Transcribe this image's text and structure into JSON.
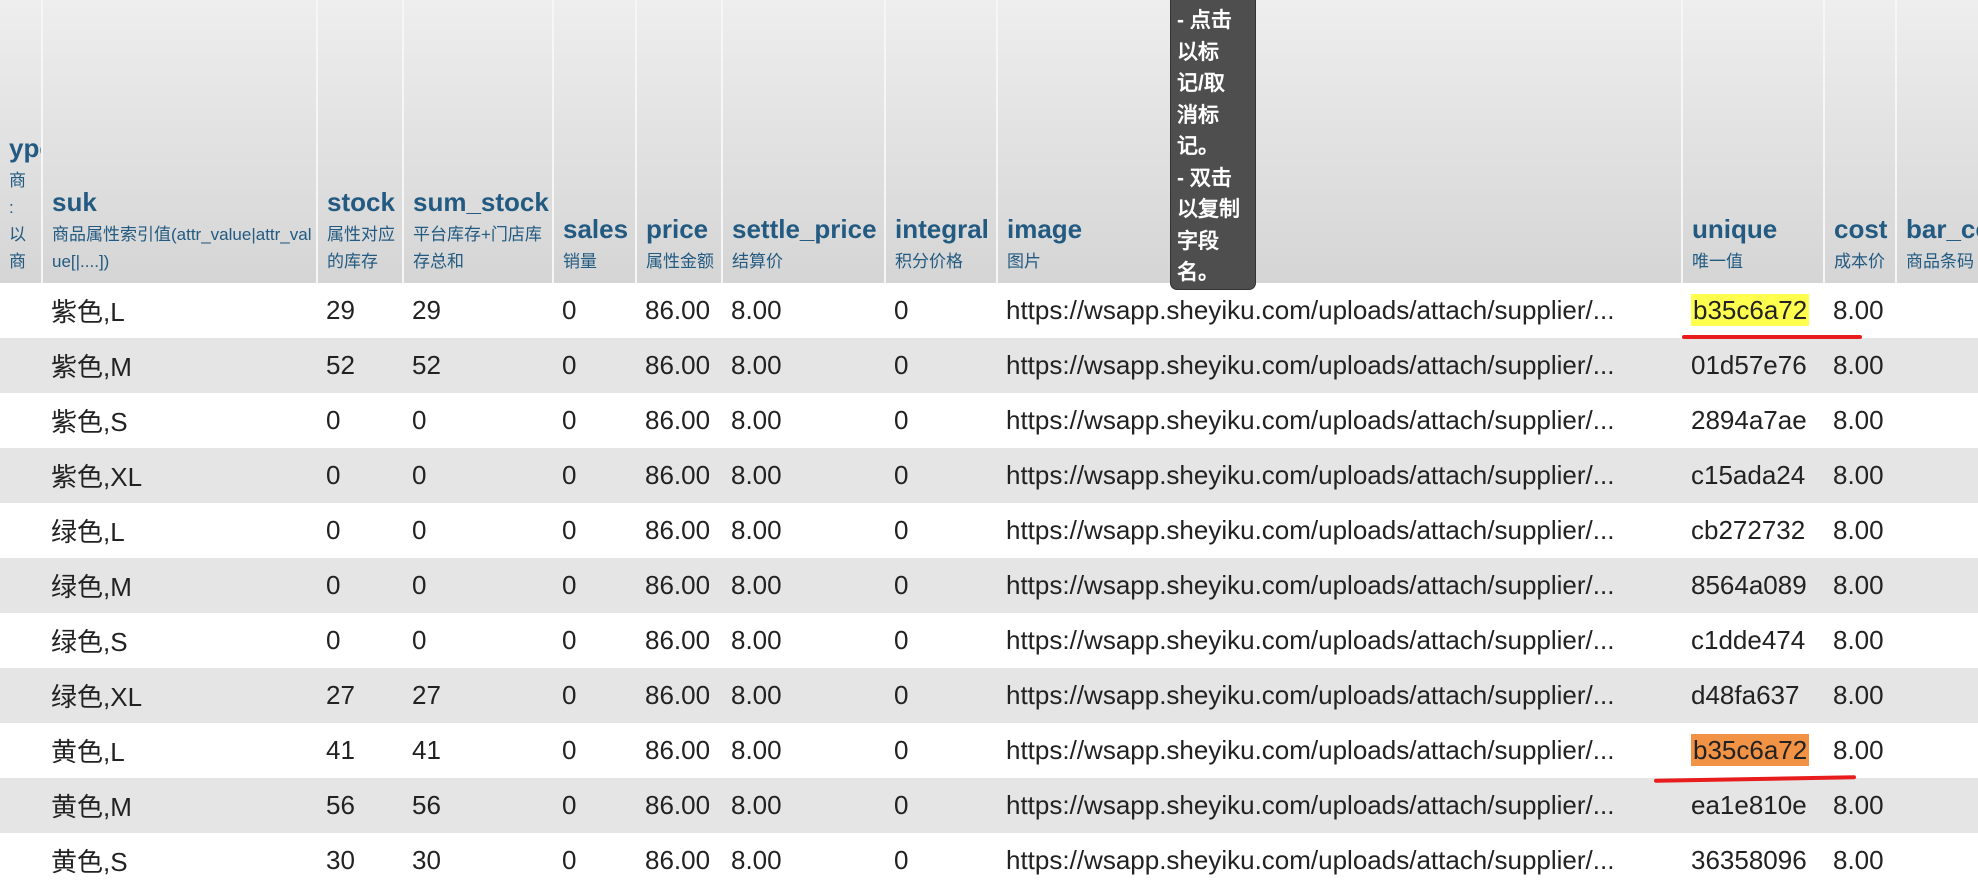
{
  "columns": [
    {
      "name": "ype",
      "comment": "商\n:\n以商"
    },
    {
      "name": "suk",
      "comment": "商品属性索引值(attr_value|attr_value[|....])"
    },
    {
      "name": "stock",
      "comment": "属性对应的库存"
    },
    {
      "name": "sum_stock",
      "comment": "平台库存+门店库存总和"
    },
    {
      "name": "sales",
      "comment": "销量"
    },
    {
      "name": "price",
      "comment": "属性金额"
    },
    {
      "name": "settle_price",
      "comment": "结算价"
    },
    {
      "name": "integral",
      "comment": "积分价格"
    },
    {
      "name": "image",
      "comment": "图片"
    },
    {
      "name": "unique",
      "comment": "唯一值"
    },
    {
      "name": "cost",
      "comment": "成本价"
    },
    {
      "name": "bar_co",
      "comment": "商品条码"
    }
  ],
  "rows": [
    {
      "suk": "紫色,L",
      "stock": "29",
      "sum_stock": "29",
      "sales": "0",
      "price": "86.00",
      "settle_price": "8.00",
      "integral": "0",
      "image": "https://wsapp.sheyiku.com/uploads/attach/supplier/...",
      "unique": "b35c6a72",
      "cost": "8.00"
    },
    {
      "suk": "紫色,M",
      "stock": "52",
      "sum_stock": "52",
      "sales": "0",
      "price": "86.00",
      "settle_price": "8.00",
      "integral": "0",
      "image": "https://wsapp.sheyiku.com/uploads/attach/supplier/...",
      "unique": "01d57e76",
      "cost": "8.00"
    },
    {
      "suk": "紫色,S",
      "stock": "0",
      "sum_stock": "0",
      "sales": "0",
      "price": "86.00",
      "settle_price": "8.00",
      "integral": "0",
      "image": "https://wsapp.sheyiku.com/uploads/attach/supplier/...",
      "unique": "2894a7ae",
      "cost": "8.00"
    },
    {
      "suk": "紫色,XL",
      "stock": "0",
      "sum_stock": "0",
      "sales": "0",
      "price": "86.00",
      "settle_price": "8.00",
      "integral": "0",
      "image": "https://wsapp.sheyiku.com/uploads/attach/supplier/...",
      "unique": "c15ada24",
      "cost": "8.00"
    },
    {
      "suk": "绿色,L",
      "stock": "0",
      "sum_stock": "0",
      "sales": "0",
      "price": "86.00",
      "settle_price": "8.00",
      "integral": "0",
      "image": "https://wsapp.sheyiku.com/uploads/attach/supplier/...",
      "unique": "cb272732",
      "cost": "8.00"
    },
    {
      "suk": "绿色,M",
      "stock": "0",
      "sum_stock": "0",
      "sales": "0",
      "price": "86.00",
      "settle_price": "8.00",
      "integral": "0",
      "image": "https://wsapp.sheyiku.com/uploads/attach/supplier/...",
      "unique": "8564a089",
      "cost": "8.00"
    },
    {
      "suk": "绿色,S",
      "stock": "0",
      "sum_stock": "0",
      "sales": "0",
      "price": "86.00",
      "settle_price": "8.00",
      "integral": "0",
      "image": "https://wsapp.sheyiku.com/uploads/attach/supplier/...",
      "unique": "c1dde474",
      "cost": "8.00"
    },
    {
      "suk": "绿色,XL",
      "stock": "27",
      "sum_stock": "27",
      "sales": "0",
      "price": "86.00",
      "settle_price": "8.00",
      "integral": "0",
      "image": "https://wsapp.sheyiku.com/uploads/attach/supplier/...",
      "unique": "d48fa637",
      "cost": "8.00"
    },
    {
      "suk": "黄色,L",
      "stock": "41",
      "sum_stock": "41",
      "sales": "0",
      "price": "86.00",
      "settle_price": "8.00",
      "integral": "0",
      "image": "https://wsapp.sheyiku.com/uploads/attach/supplier/...",
      "unique": "b35c6a72",
      "cost": "8.00"
    },
    {
      "suk": "黄色,M",
      "stock": "56",
      "sum_stock": "56",
      "sales": "0",
      "price": "86.00",
      "settle_price": "8.00",
      "integral": "0",
      "image": "https://wsapp.sheyiku.com/uploads/attach/supplier/...",
      "unique": "ea1e810e",
      "cost": "8.00"
    },
    {
      "suk": "黄色,S",
      "stock": "30",
      "sum_stock": "30",
      "sales": "0",
      "price": "86.00",
      "settle_price": "8.00",
      "integral": "0",
      "image": "https://wsapp.sheyiku.com/uploads/attach/supplier/...",
      "unique": "36358096",
      "cost": "8.00"
    }
  ],
  "highlights": {
    "row1_unique_color": "#ffff4d",
    "row9_unique_color": "#f29245",
    "underline_color": "#e81c1c"
  },
  "tooltip": {
    "text": "- 点击\n以标\n记/取\n消标\n记。\n- 双击\n以复制\n字段\n名。"
  }
}
